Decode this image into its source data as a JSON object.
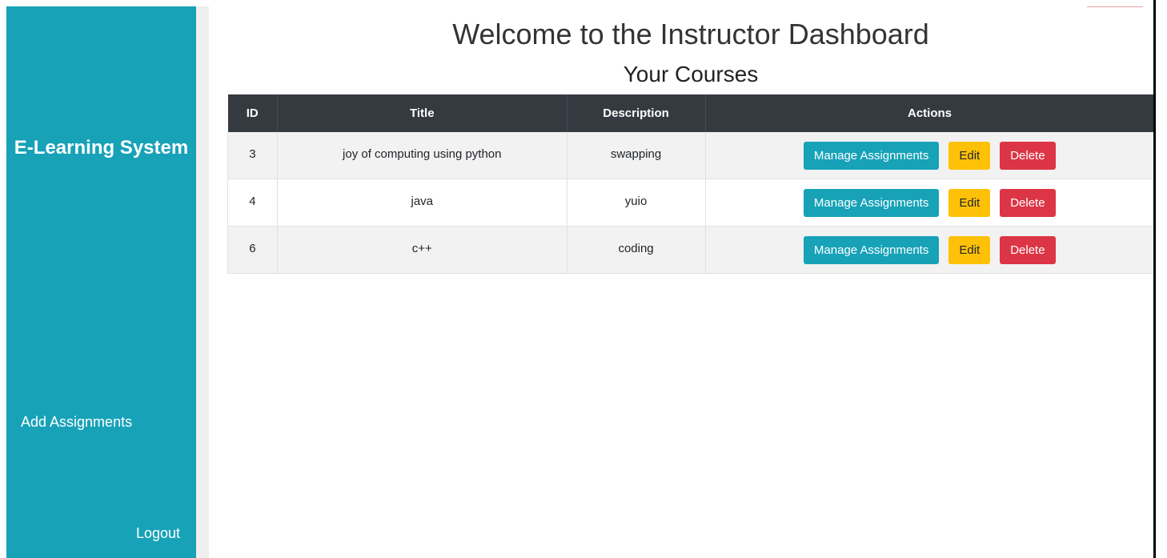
{
  "sidebar": {
    "brand": "E-Learning System",
    "add_assignments": "Add Assignments",
    "logout": "Logout"
  },
  "main": {
    "title": "Welcome to the Instructor Dashboard",
    "subtitle": "Your Courses"
  },
  "table": {
    "headers": [
      "ID",
      "Title",
      "Description",
      "Actions"
    ],
    "rows": [
      {
        "id": "3",
        "title": "joy of computing using python",
        "description": "swapping"
      },
      {
        "id": "4",
        "title": "java",
        "description": "yuio"
      },
      {
        "id": "6",
        "title": "c++",
        "description": "coding"
      }
    ],
    "actions": {
      "manage": "Manage Assignments",
      "edit": "Edit",
      "delete": "Delete"
    }
  },
  "colors": {
    "sidebar": "#17a2b8",
    "table_header": "#343a40",
    "manage_button": "#17a2b8",
    "edit_button": "#ffc107",
    "delete_button": "#dc3545"
  }
}
